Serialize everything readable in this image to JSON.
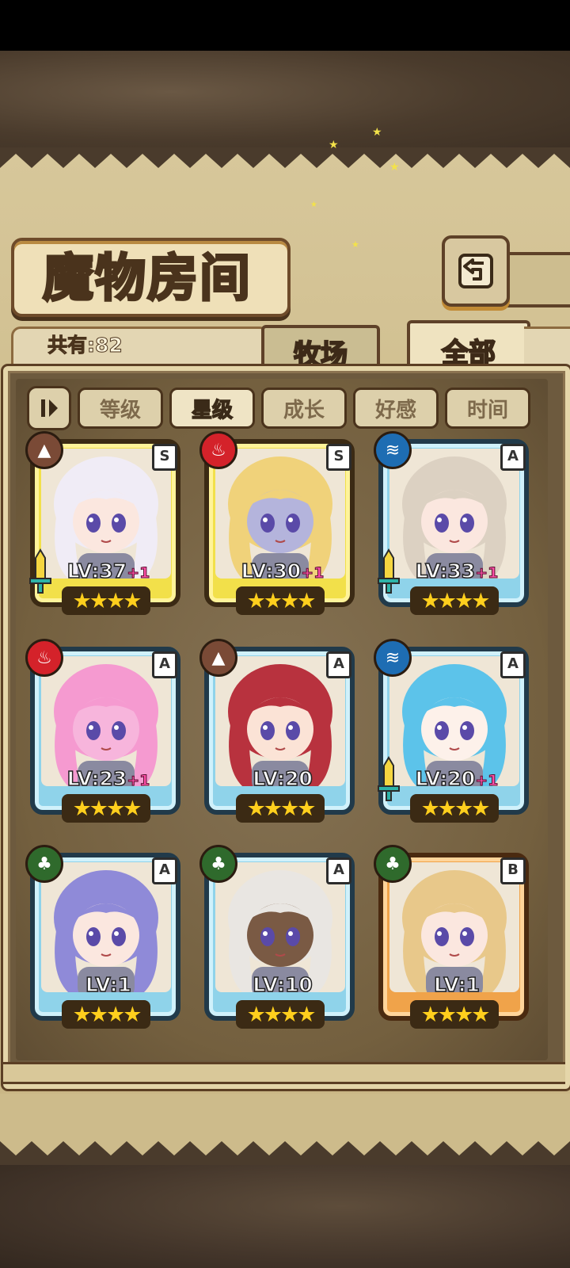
{
  "title": "魔物房间",
  "count_label": "共有:82",
  "tabs": [
    {
      "label": "牧场",
      "active": false
    },
    {
      "label": "全部",
      "active": true
    }
  ],
  "sort_buttons": [
    {
      "label": "等级",
      "selected": false
    },
    {
      "label": "星级",
      "selected": true
    },
    {
      "label": "成长",
      "selected": false
    },
    {
      "label": "好感",
      "selected": false
    },
    {
      "label": "时间",
      "selected": false
    }
  ],
  "icons": {
    "back": "back-arrow-icon",
    "sort_toggle": "sort-order-icon"
  },
  "monsters": [
    {
      "rank": "S",
      "element": "earth",
      "level": "LV:37",
      "bonus": "+1",
      "stars": 4,
      "equipped": true,
      "hair": "#f0ecf6",
      "skin": "#fbe7df"
    },
    {
      "rank": "S",
      "element": "fire",
      "level": "LV:30",
      "bonus": "+1",
      "stars": 4,
      "equipped": false,
      "hair": "#f0d27a",
      "skin": "#b4b4dc"
    },
    {
      "rank": "A",
      "element": "water",
      "level": "LV:33",
      "bonus": "+1",
      "stars": 4,
      "equipped": true,
      "hair": "#dcd1c2",
      "skin": "#fbe7df"
    },
    {
      "rank": "A",
      "element": "fire",
      "level": "LV:23",
      "bonus": "+1",
      "stars": 4,
      "equipped": false,
      "hair": "#f59ad0",
      "skin": "#f7b5dc"
    },
    {
      "rank": "A",
      "element": "earth",
      "level": "LV:20",
      "bonus": "",
      "stars": 4,
      "equipped": false,
      "hair": "#b8323e",
      "skin": "#fbe3d6"
    },
    {
      "rank": "A",
      "element": "water",
      "level": "LV:20",
      "bonus": "+1",
      "stars": 4,
      "equipped": true,
      "hair": "#5cc3ea",
      "skin": "#fdf1ea"
    },
    {
      "rank": "A",
      "element": "wood",
      "level": "LV:1",
      "bonus": "",
      "stars": 4,
      "equipped": false,
      "hair": "#8f8ad8",
      "skin": "#fbe7df"
    },
    {
      "rank": "A",
      "element": "wood",
      "level": "LV:10",
      "bonus": "",
      "stars": 4,
      "equipped": false,
      "hair": "#e9e6e2",
      "skin": "#7a5a44"
    },
    {
      "rank": "B",
      "element": "wood",
      "level": "LV:1",
      "bonus": "",
      "stars": 4,
      "equipped": false,
      "hair": "#e8c88a",
      "skin": "#fbe7df"
    }
  ],
  "colors": {
    "rank_S": "#f2e04a",
    "rank_A": "#8fd3ea",
    "rank_B": "#f0a34a",
    "star": "#ffcf1d",
    "bonus": "#ff4fa8"
  }
}
